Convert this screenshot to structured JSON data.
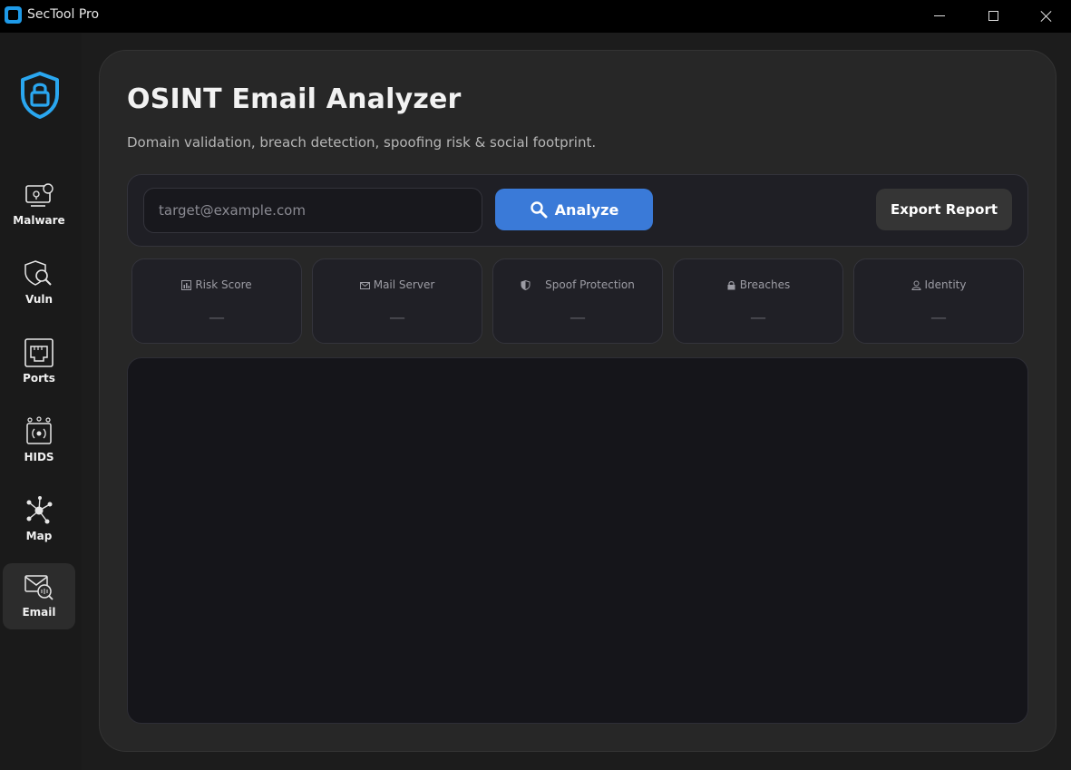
{
  "window": {
    "title": "SecTool Pro"
  },
  "sidebar": {
    "items": [
      {
        "label": "Malware",
        "icon": "malware-icon"
      },
      {
        "label": "Vuln",
        "icon": "vuln-scan-icon"
      },
      {
        "label": "Ports",
        "icon": "ethernet-port-icon"
      },
      {
        "label": "HIDS",
        "icon": "hids-icon"
      },
      {
        "label": "Map",
        "icon": "network-map-icon"
      },
      {
        "label": "Email",
        "icon": "email-search-icon",
        "active": true
      }
    ]
  },
  "page": {
    "title": "OSINT Email Analyzer",
    "subtitle": "Domain validation, breach detection, spoofing risk & social footprint."
  },
  "toolbar": {
    "email_placeholder": "target@example.com",
    "email_value": "",
    "analyze_label": "Analyze",
    "export_label": "Export Report"
  },
  "stats": [
    {
      "label": "Risk Score",
      "value": "—",
      "icon": "chart-icon"
    },
    {
      "label": "Mail Server",
      "value": "—",
      "icon": "envelope-icon"
    },
    {
      "label": "Spoof Protection",
      "value": "—",
      "icon": "shield-icon"
    },
    {
      "label": "Breaches",
      "value": "—",
      "icon": "lock-icon"
    },
    {
      "label": "Identity",
      "value": "—",
      "icon": "person-icon"
    }
  ],
  "colors": {
    "accent": "#3a7ad8",
    "brand": "#1e9ae8",
    "background": "#1c1c1c",
    "card": "#272727"
  }
}
